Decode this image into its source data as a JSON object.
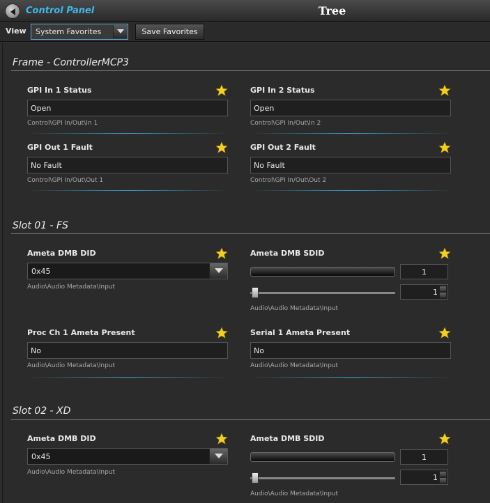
{
  "app": {
    "back_label": "Control Panel",
    "title": "Tree"
  },
  "toolbar": {
    "view_label": "View",
    "view_value": "System Favorites",
    "save_label": "Save Favorites"
  },
  "sections": [
    {
      "title": "Frame - ControllerMCP3",
      "items": [
        {
          "label": "GPI In 1 Status",
          "value": "Open",
          "path": "Control\\GPI In/Out\\In 1"
        },
        {
          "label": "GPI In 2 Status",
          "value": "Open",
          "path": "Control\\GPI In/Out\\In 2"
        },
        {
          "label": "GPI Out 1 Fault",
          "value": "No Fault",
          "path": "Control\\GPI In/Out\\Out 1"
        },
        {
          "label": "GPI Out 2 Fault",
          "value": "No Fault",
          "path": "Control\\GPI In/Out\\Out 2"
        }
      ]
    },
    {
      "title": "Slot 01 - FS",
      "items": [
        {
          "label": "Ameta DMB DID",
          "value": "0x45",
          "path": "Audio\\Audio Metadata\\Input"
        },
        {
          "label": "Ameta DMB SDID",
          "slider_value": "1",
          "spin_value": "1",
          "path": "Audio\\Audio Metadata\\Input"
        },
        {
          "label": "Proc Ch 1 Ameta Present",
          "value": "No",
          "path": "Audio\\Audio Metadata\\Input"
        },
        {
          "label": "Serial 1 Ameta Present",
          "value": "No",
          "path": "Audio\\Audio Metadata\\Input"
        }
      ]
    },
    {
      "title": "Slot 02 - XD",
      "items": [
        {
          "label": "Ameta DMB DID",
          "value": "0x45",
          "path": "Audio\\Audio Metadata\\Input"
        },
        {
          "label": "Ameta DMB SDID",
          "slider_value": "1",
          "spin_value": "1",
          "path": "Audio\\Audio Metadata\\Input"
        }
      ]
    }
  ],
  "colors": {
    "accent": "#3fb8e8",
    "star": "#f5d020"
  }
}
